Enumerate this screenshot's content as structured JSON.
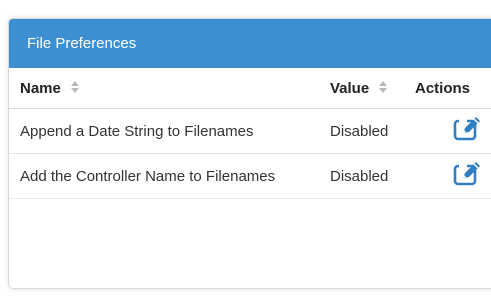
{
  "panel": {
    "title": "File Preferences"
  },
  "table": {
    "headers": {
      "name": "Name",
      "value": "Value",
      "actions": "Actions"
    },
    "rows": [
      {
        "name": "Append a Date String to Filenames",
        "value": "Disabled"
      },
      {
        "name": "Add the Controller Name to Filenames",
        "value": "Disabled"
      }
    ]
  },
  "icons": {
    "sort": "sort-icon",
    "edit": "edit-icon"
  },
  "colors": {
    "header_bg": "#3e8fd1",
    "icon_blue": "#2f7fc2"
  }
}
